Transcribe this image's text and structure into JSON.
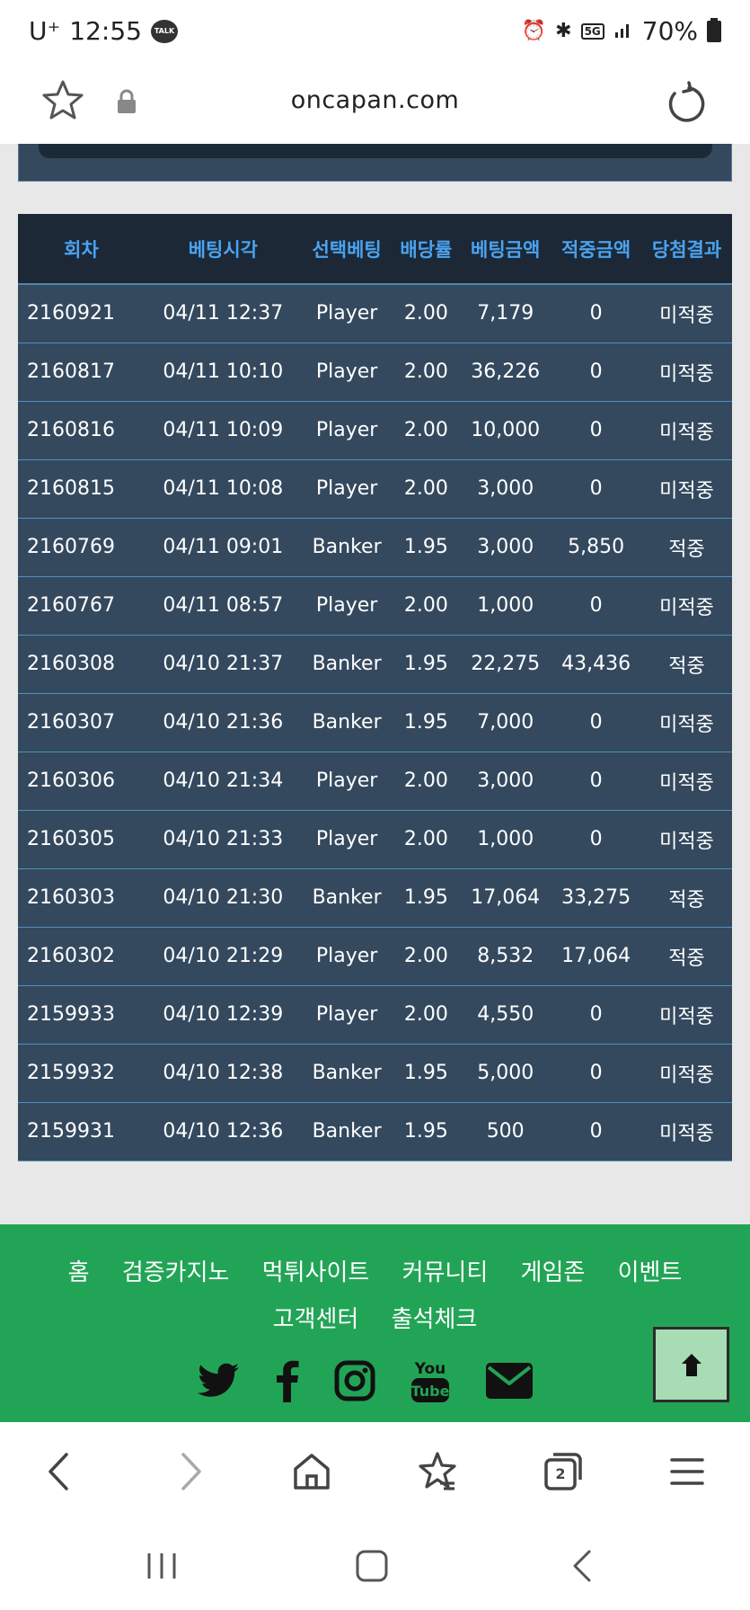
{
  "status_bar": {
    "carrier": "U⁺",
    "time": "12:55",
    "talk_badge": "TALK",
    "network": "5G",
    "battery": "70%"
  },
  "address_bar": {
    "url": "oncapan.com"
  },
  "table": {
    "headers": [
      "회차",
      "베팅시각",
      "선택베팅",
      "배당률",
      "베팅금액",
      "적중금액",
      "당첨결과"
    ],
    "rows": [
      [
        "2160921",
        "04/11 12:37",
        "Player",
        "2.00",
        "7,179",
        "0",
        "미적중"
      ],
      [
        "2160817",
        "04/11 10:10",
        "Player",
        "2.00",
        "36,226",
        "0",
        "미적중"
      ],
      [
        "2160816",
        "04/11 10:09",
        "Player",
        "2.00",
        "10,000",
        "0",
        "미적중"
      ],
      [
        "2160815",
        "04/11 10:08",
        "Player",
        "2.00",
        "3,000",
        "0",
        "미적중"
      ],
      [
        "2160769",
        "04/11 09:01",
        "Banker",
        "1.95",
        "3,000",
        "5,850",
        "적중"
      ],
      [
        "2160767",
        "04/11 08:57",
        "Player",
        "2.00",
        "1,000",
        "0",
        "미적중"
      ],
      [
        "2160308",
        "04/10 21:37",
        "Banker",
        "1.95",
        "22,275",
        "43,436",
        "적중"
      ],
      [
        "2160307",
        "04/10 21:36",
        "Banker",
        "1.95",
        "7,000",
        "0",
        "미적중"
      ],
      [
        "2160306",
        "04/10 21:34",
        "Player",
        "2.00",
        "3,000",
        "0",
        "미적중"
      ],
      [
        "2160305",
        "04/10 21:33",
        "Player",
        "2.00",
        "1,000",
        "0",
        "미적중"
      ],
      [
        "2160303",
        "04/10 21:30",
        "Banker",
        "1.95",
        "17,064",
        "33,275",
        "적중"
      ],
      [
        "2160302",
        "04/10 21:29",
        "Player",
        "2.00",
        "8,532",
        "17,064",
        "적중"
      ],
      [
        "2159933",
        "04/10 12:39",
        "Player",
        "2.00",
        "4,550",
        "0",
        "미적중"
      ],
      [
        "2159932",
        "04/10 12:38",
        "Banker",
        "1.95",
        "5,000",
        "0",
        "미적중"
      ],
      [
        "2159931",
        "04/10 12:36",
        "Banker",
        "1.95",
        "500",
        "0",
        "미적중"
      ]
    ]
  },
  "colors": {
    "result_win": "#f5a623",
    "result_lose": "#e02020",
    "footer_bg": "#22a456",
    "table_bg": "#34495e"
  },
  "footer": {
    "nav": [
      "홈",
      "검증카지노",
      "먹튀사이트",
      "커뮤니티",
      "게임존",
      "이벤트",
      "고객센터",
      "출석체크"
    ],
    "social": [
      "twitter-icon",
      "facebook-icon",
      "instagram-icon",
      "youtube-icon",
      "email-icon"
    ],
    "youtube_top": "You",
    "youtube_bottom": "Tube"
  },
  "browser_toolbar": {
    "tab_count": "2"
  }
}
